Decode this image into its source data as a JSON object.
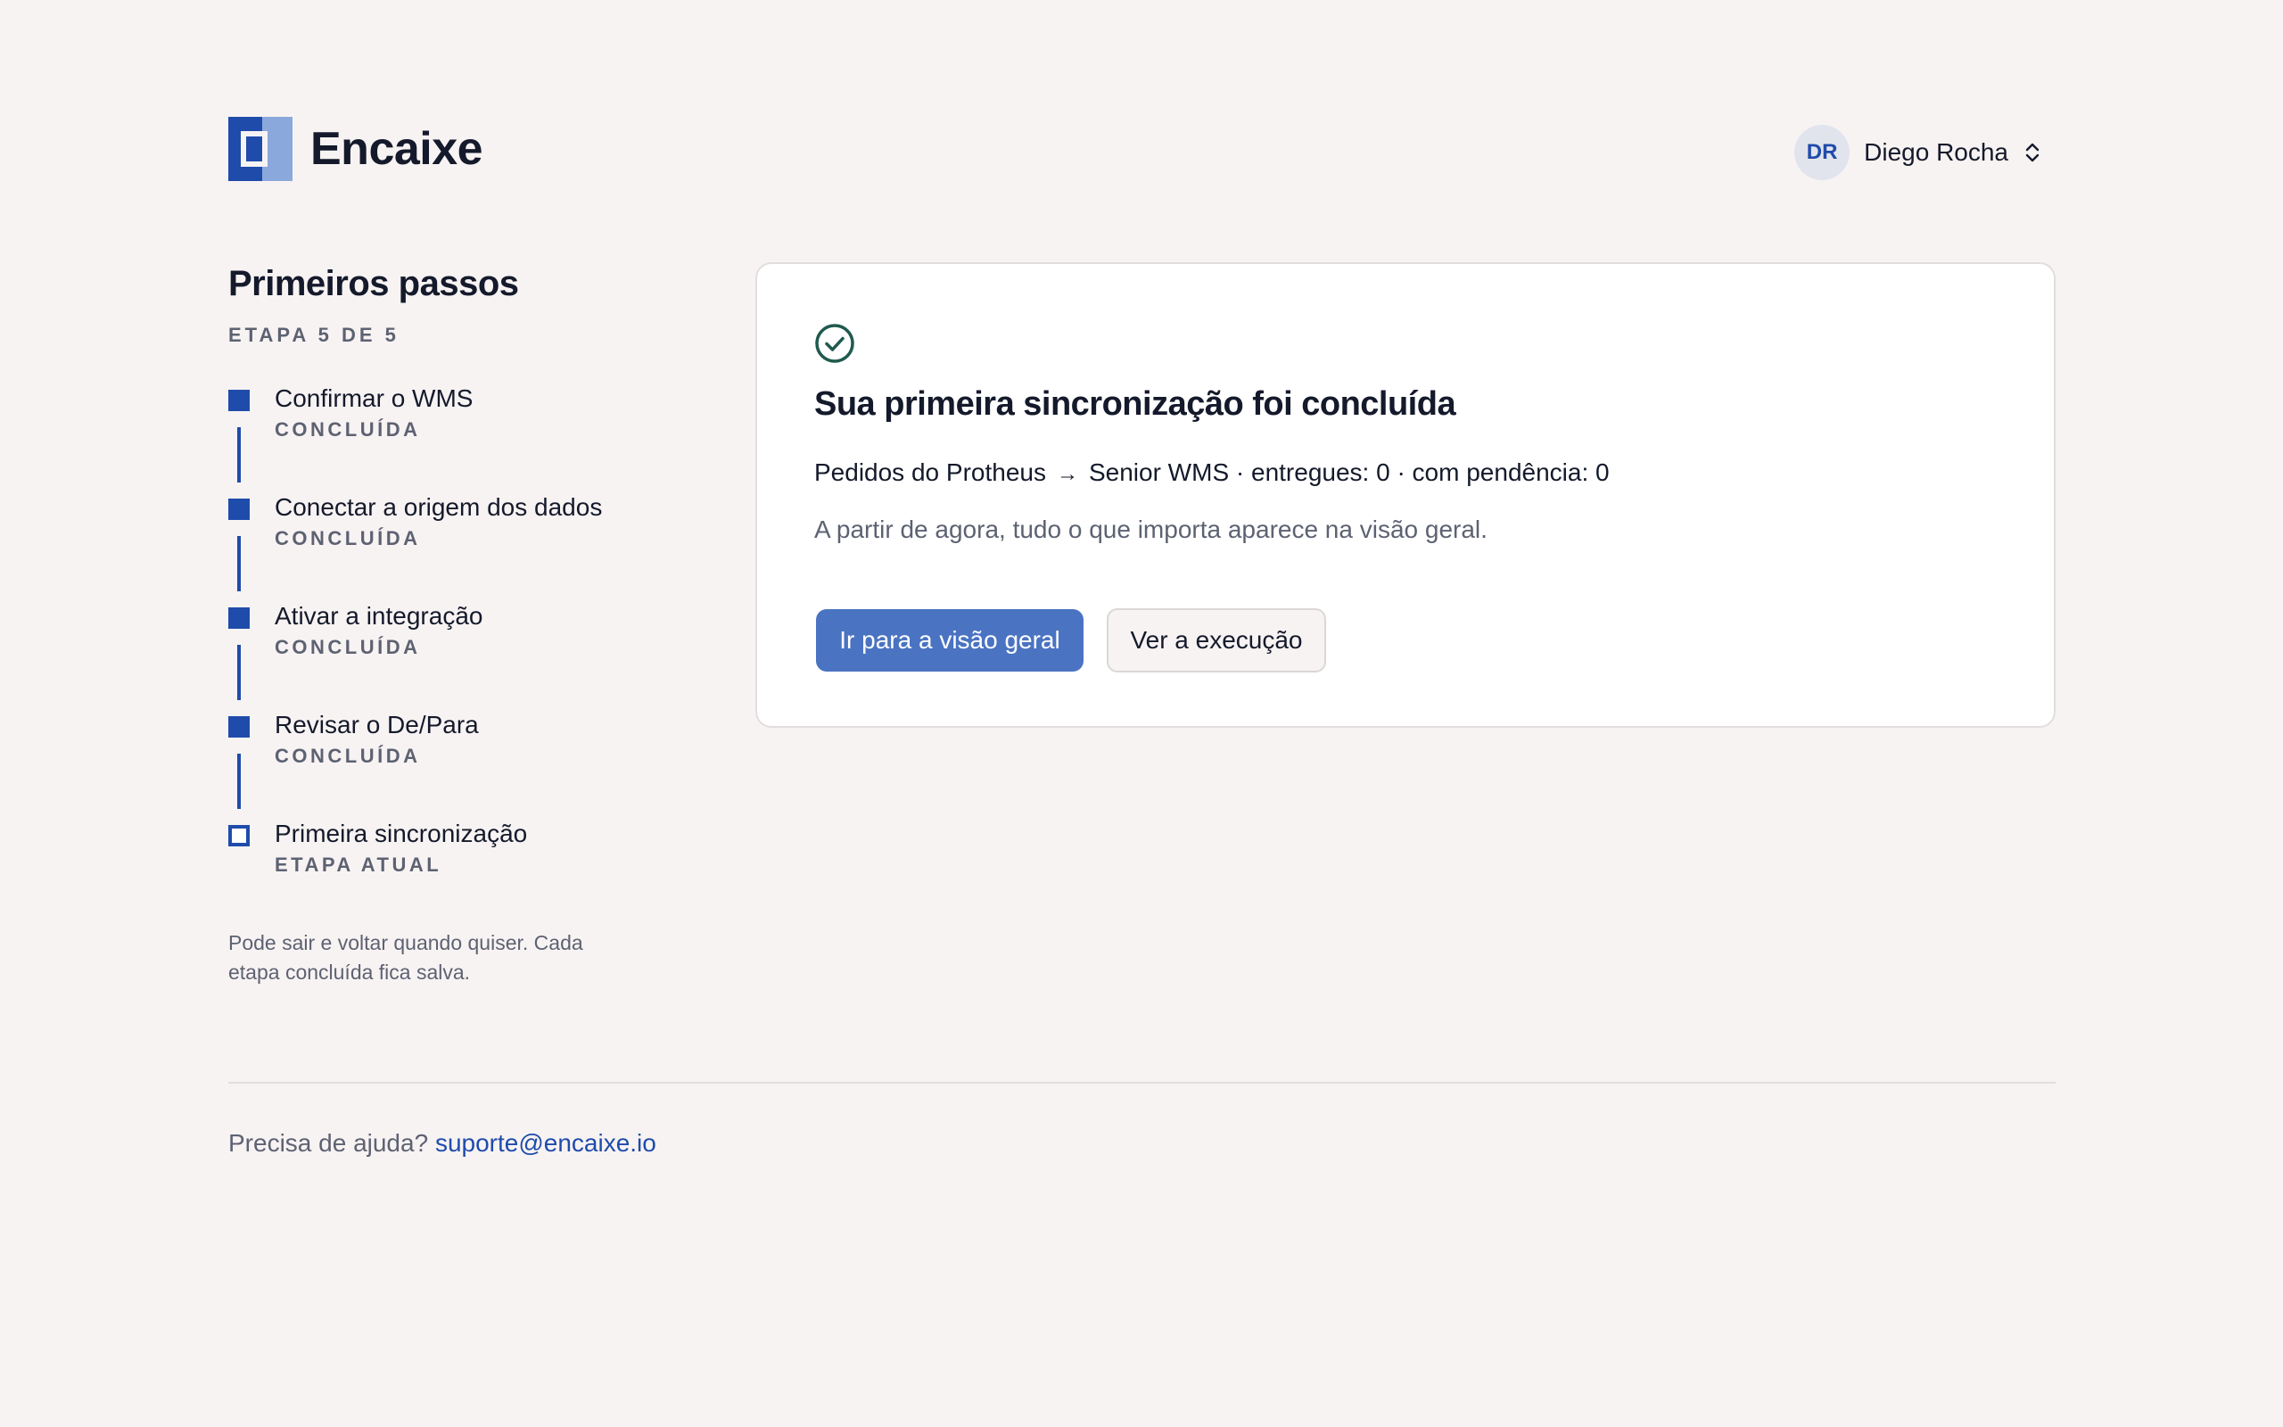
{
  "brand": {
    "name": "Encaixe"
  },
  "user": {
    "initials": "DR",
    "name": "Diego Rocha"
  },
  "sidebar": {
    "title": "Primeiros passos",
    "subtitle": "ETAPA 5 DE 5",
    "steps": [
      {
        "label": "Confirmar o WMS",
        "status": "CONCLUÍDA"
      },
      {
        "label": "Conectar a origem dos dados",
        "status": "CONCLUÍDA"
      },
      {
        "label": "Ativar a integração",
        "status": "CONCLUÍDA"
      },
      {
        "label": "Revisar o De/Para",
        "status": "CONCLUÍDA"
      },
      {
        "label": "Primeira sincronização",
        "status": "ETAPA ATUAL"
      }
    ],
    "note": "Pode sair e voltar quando quiser. Cada etapa concluída fica salva."
  },
  "card": {
    "title": "Sua primeira sincronização foi concluída",
    "source": "Pedidos do Protheus",
    "arrow": "→",
    "meta_rest": "Senior WMS · entregues: 0 · com pendência: 0",
    "description": "A partir de agora, tudo o que importa aparece na visão geral.",
    "primary_button": "Ir para a visão geral",
    "secondary_button": "Ver a execução"
  },
  "footer": {
    "help_text": "Precisa de ajuda?",
    "help_email": "suporte@encaixe.io"
  },
  "colors": {
    "accent": "#1f4cab",
    "primary_button": "#4a73c2",
    "success": "#1f5a4e",
    "background": "#f8f3f3"
  },
  "icons": {
    "check": "check-circle-icon",
    "user_menu": "chevron-up-down-icon"
  }
}
